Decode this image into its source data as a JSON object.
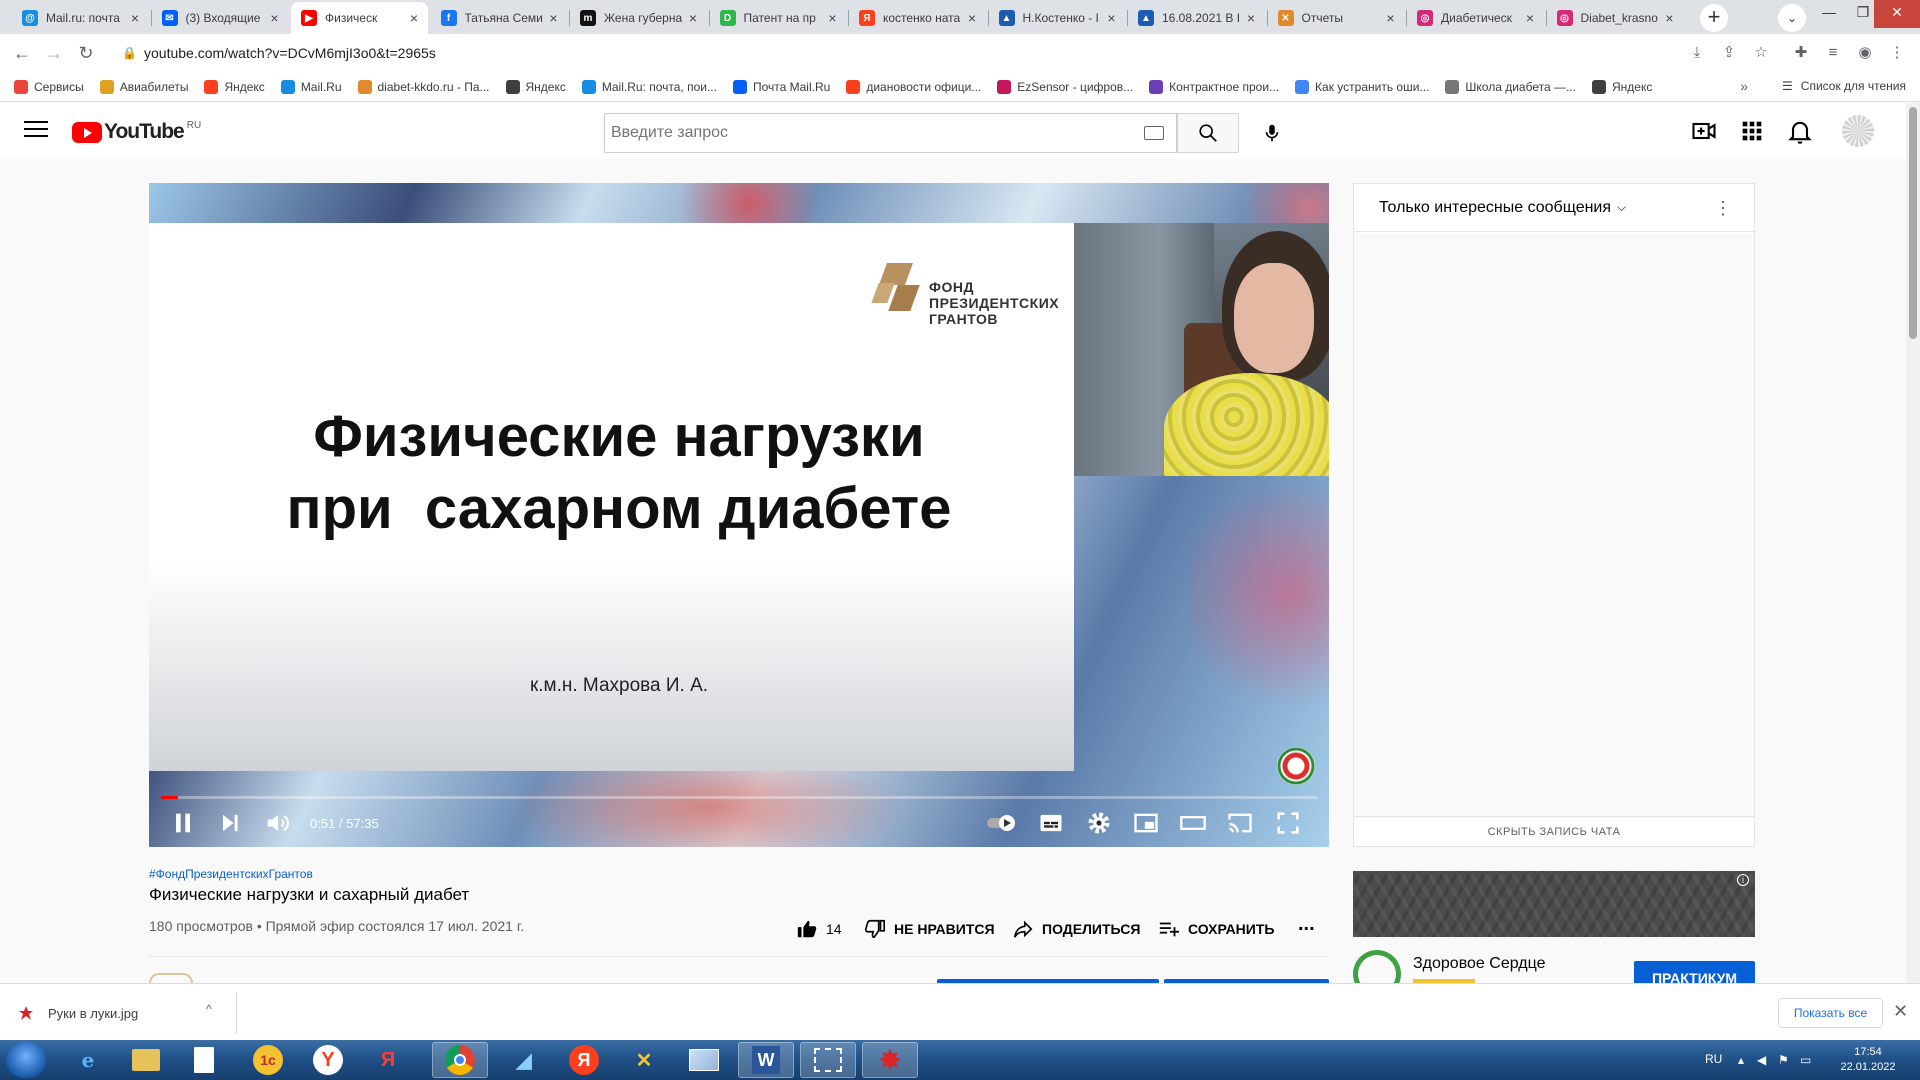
{
  "browser": {
    "tabs": [
      {
        "label": "Mail.ru: почта",
        "icon_color": "#168de2",
        "icon_char": "@",
        "active": false
      },
      {
        "label": "(3) Входящие",
        "icon_color": "#005ff9",
        "icon_char": "✉",
        "active": false
      },
      {
        "label": "Физическ",
        "icon_color": "#ff0000",
        "icon_char": "▶",
        "active": true
      },
      {
        "label": "Татьяна Семи",
        "icon_color": "#1877f2",
        "icon_char": "f",
        "active": false
      },
      {
        "label": "Жена губерна",
        "icon_color": "#111111",
        "icon_char": "m",
        "active": false
      },
      {
        "label": "Патент на пр",
        "icon_color": "#2fb84a",
        "icon_char": "D",
        "active": false
      },
      {
        "label": "костенко ната",
        "icon_color": "#fc3f1d",
        "icon_char": "Я",
        "active": false
      },
      {
        "label": "Н.Костенко - I",
        "icon_color": "#1c5cb2",
        "icon_char": "▲",
        "active": false
      },
      {
        "label": "16.08.2021 В I",
        "icon_color": "#1c5cb2",
        "icon_char": "▲",
        "active": false
      },
      {
        "label": "Отчеты",
        "icon_color": "#e08a2c",
        "icon_char": "✕",
        "active": false
      },
      {
        "label": "Диабетическ",
        "icon_color": "#d62976",
        "icon_char": "◎",
        "active": false
      },
      {
        "label": "Diabet_krasno",
        "icon_color": "#d62976",
        "icon_char": "◎",
        "active": false
      }
    ],
    "url": "youtube.com/watch?v=DCvM6mjI3o0&t=2965s",
    "bookmarks": [
      {
        "label": "Сервисы",
        "icon_color": "#e8453c"
      },
      {
        "label": "Авиабилеты",
        "icon_color": "#e0a020"
      },
      {
        "label": "Яндекс",
        "icon_color": "#fc3f1d"
      },
      {
        "label": "Mail.Ru",
        "icon_color": "#168de2"
      },
      {
        "label": "diabet-kkdo.ru - Па...",
        "icon_color": "#e08a2c"
      },
      {
        "label": "Яндекс",
        "icon_color": "#3c4043"
      },
      {
        "label": "Mail.Ru: почта, пои...",
        "icon_color": "#168de2"
      },
      {
        "label": "Почта Mail.Ru",
        "icon_color": "#005ff9"
      },
      {
        "label": "дианoвости офици...",
        "icon_color": "#fc3f1d"
      },
      {
        "label": "EzSensor - цифров...",
        "icon_color": "#c2185b"
      },
      {
        "label": "Контрактное прои...",
        "icon_color": "#6a3fb5"
      },
      {
        "label": "Как устранить оши...",
        "icon_color": "#4285f4"
      },
      {
        "label": "Школа диабета —...",
        "icon_color": "#777777"
      },
      {
        "label": "Яндекс",
        "icon_color": "#3c4043"
      }
    ],
    "bookmarks_more": "»",
    "reading_list": "Список для чтения"
  },
  "youtube": {
    "logo_text": "YouTube",
    "country": "RU",
    "search_placeholder": "Введите запрос"
  },
  "player": {
    "slide_title_line1": "Физические нагрузки",
    "slide_title_line2": "при  сахарном диабете",
    "slide_author": "к.м.н. Махрова И. А.",
    "fund_line1": "ФОНД",
    "fund_line2": "ПРЕЗИДЕНТСКИХ",
    "fund_line3": "ГРАНТОВ",
    "time": "0:51 / 57:35",
    "progress_fraction": 0.0148
  },
  "video": {
    "hashtag": "#ФондПрезидентскихГрантов",
    "title": "Физические нагрузки и сахарный диабет",
    "meta": "180 просмотров • Прямой эфир состоялся 17 июл. 2021 г.",
    "likes": "14",
    "dislike_label": "НЕ НРАВИТСЯ",
    "share_label": "ПОДЕЛИТЬСЯ",
    "save_label": "СОХРАНИТЬ",
    "more_label": "..."
  },
  "chat": {
    "mode_label": "Только интересные сообщения",
    "hide_label": "СКРЫТЬ ЗАПИСЬ ЧАТА"
  },
  "ad": {
    "name": "Здоровое Сердце",
    "cta": "ПРАКТИКУМ"
  },
  "downloads": {
    "file": "Руки в луки.jpg",
    "show_all": "Показать все"
  },
  "taskbar": {
    "lang": "RU",
    "time": "17:54",
    "date": "22.01.2022"
  }
}
